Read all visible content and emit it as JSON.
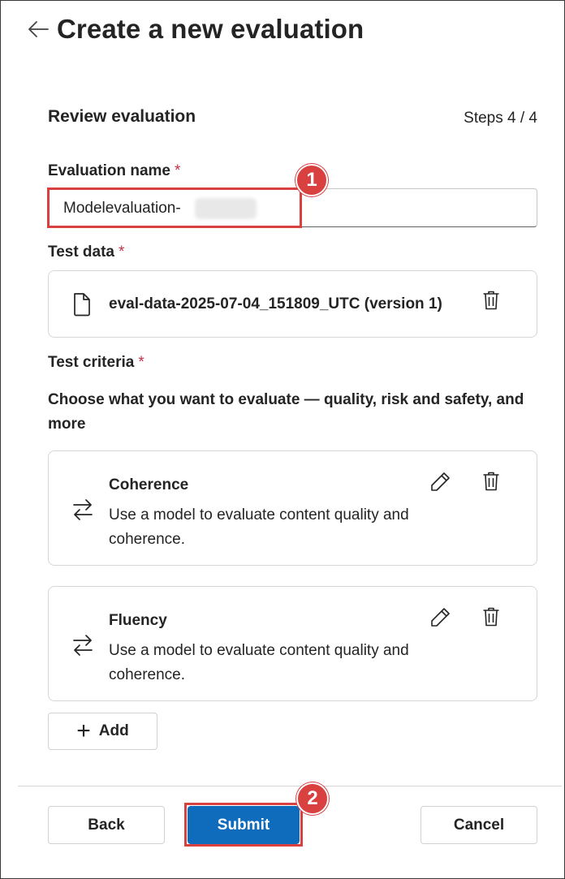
{
  "header": {
    "title": "Create a new evaluation",
    "back_icon": "arrow-left-icon"
  },
  "review": {
    "title": "Review evaluation",
    "steps": "Steps 4 / 4"
  },
  "evaluation_name": {
    "label": "Evaluation name",
    "required_mark": "*",
    "value": "Modelevaluation-"
  },
  "test_data": {
    "label": "Test data",
    "required_mark": "*",
    "file_name": "eval-data-2025-07-04_151809_UTC (version 1)",
    "file_icon": "document-icon",
    "delete_icon": "trash-icon"
  },
  "test_criteria": {
    "label": "Test criteria",
    "required_mark": "*",
    "description": "Choose what you want to evaluate — quality, risk and safety, and more",
    "items": [
      {
        "title": "Coherence",
        "description": "Use a model to evaluate content quality and coherence.",
        "icon": "arrows-swap-icon"
      },
      {
        "title": "Fluency",
        "description": "Use a model to evaluate content quality and coherence.",
        "icon": "arrows-swap-icon"
      }
    ],
    "add_label": "Add"
  },
  "annotations": {
    "badge_1": "1",
    "badge_2": "2",
    "highlight_color": "#d94040"
  },
  "footer": {
    "back_label": "Back",
    "submit_label": "Submit",
    "cancel_label": "Cancel"
  },
  "colors": {
    "primary": "#0f6cbd",
    "required": "#c4314b"
  }
}
